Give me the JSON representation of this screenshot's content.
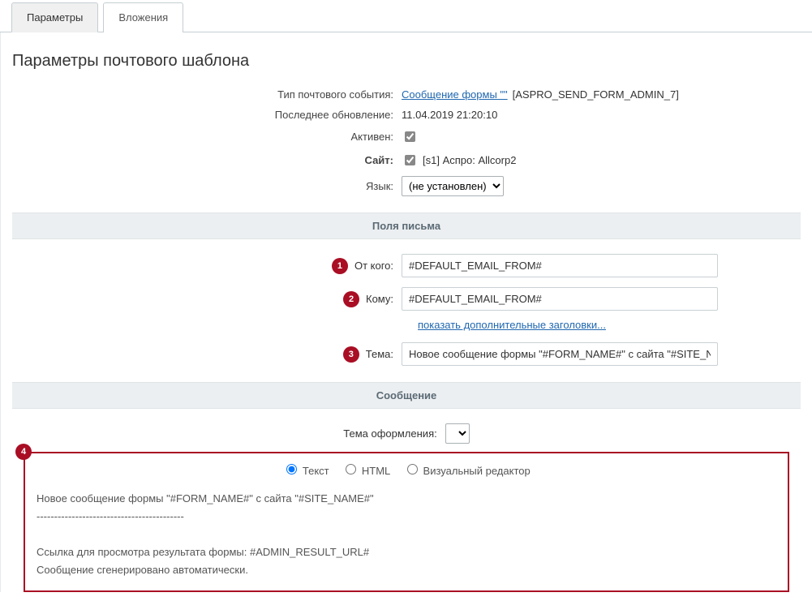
{
  "tabs": {
    "params": "Параметры",
    "attachments": "Вложения"
  },
  "page_title": "Параметры почтового шаблона",
  "fields": {
    "event_type_label": "Тип почтового события:",
    "event_type_link": "Сообщение формы \"\"",
    "event_type_code": " [ASPRO_SEND_FORM_ADMIN_7]",
    "last_update_label": "Последнее обновление:",
    "last_update_value": "11.04.2019 21:20:10",
    "active_label": "Активен:",
    "site_label": "Сайт:",
    "site_value": "[s1] Аспро: Allcorp2",
    "lang_label": "Язык:",
    "lang_value": "(не установлен)"
  },
  "section_letter": "Поля письма",
  "from": {
    "label": "От кого:",
    "value": "#DEFAULT_EMAIL_FROM#"
  },
  "to": {
    "label": "Кому:",
    "value": "#DEFAULT_EMAIL_FROM#"
  },
  "additional_link": "показать дополнительные заголовки...",
  "subject": {
    "label": "Тема:",
    "value": "Новое сообщение формы \"#FORM_NAME#\" с сайта \"#SITE_NAME#\""
  },
  "section_message": "Сообщение",
  "theme_label": "Тема оформления:",
  "editor_modes": {
    "text": "Текст",
    "html": "HTML",
    "visual": "Визуальный редактор"
  },
  "message_body": "Новое сообщение формы \"#FORM_NAME#\" с сайта \"#SITE_NAME#\"\n------------------------------------------\n\nСсылка для просмотра результата формы: #ADMIN_RESULT_URL#\nСообщение сгенерировано автоматически.",
  "badges": [
    "1",
    "2",
    "3",
    "4"
  ]
}
